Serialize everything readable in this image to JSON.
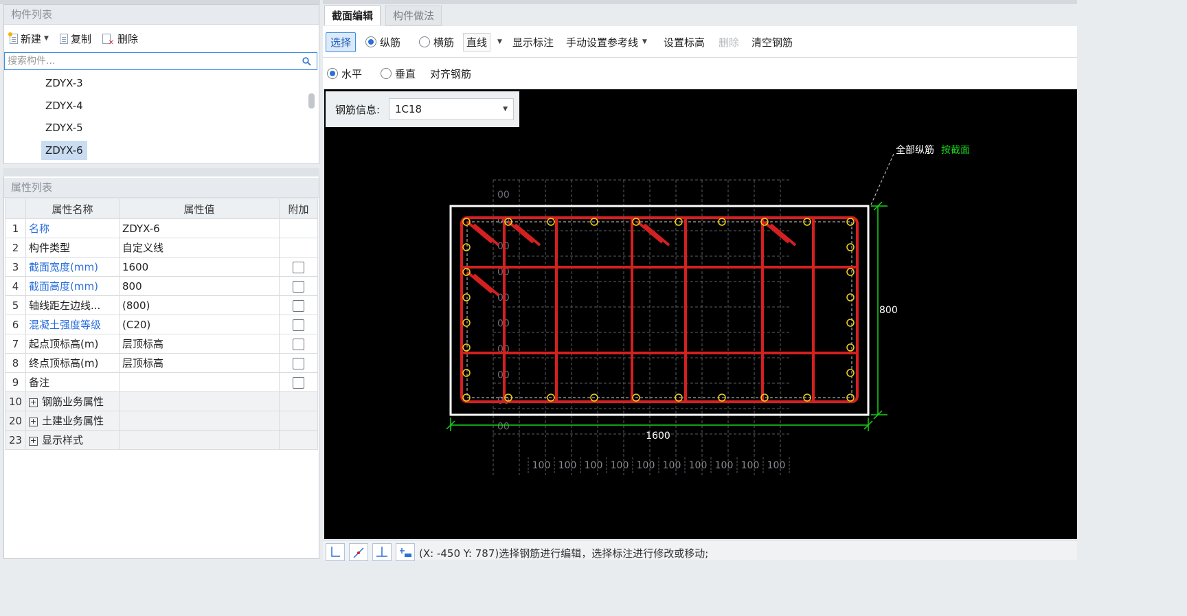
{
  "component_list": {
    "title": "构件列表",
    "toolbar": {
      "new_label": "新建",
      "copy_label": "复制",
      "delete_label": "删除"
    },
    "search_placeholder": "搜索构件...",
    "items": [
      "ZDYX-3",
      "ZDYX-4",
      "ZDYX-5",
      "ZDYX-6"
    ],
    "selected": "ZDYX-6"
  },
  "property_list": {
    "title": "属性列表",
    "columns": [
      "属性名称",
      "属性值",
      "附加"
    ],
    "rows": [
      {
        "num": "1",
        "name": "名称",
        "value": "ZDYX-6",
        "blue": true,
        "checkbox": false
      },
      {
        "num": "2",
        "name": "构件类型",
        "value": "自定义线",
        "blue": false,
        "checkbox": false
      },
      {
        "num": "3",
        "name": "截面宽度(mm)",
        "value": "1600",
        "blue": true,
        "checkbox": true
      },
      {
        "num": "4",
        "name": "截面高度(mm)",
        "value": "800",
        "blue": true,
        "checkbox": true
      },
      {
        "num": "5",
        "name": "轴线距左边线...",
        "value": "(800)",
        "blue": false,
        "checkbox": true
      },
      {
        "num": "6",
        "name": "混凝土强度等级",
        "value": "(C20)",
        "blue": true,
        "checkbox": true
      },
      {
        "num": "7",
        "name": "起点顶标高(m)",
        "value": "层顶标高",
        "blue": false,
        "checkbox": true
      },
      {
        "num": "8",
        "name": "终点顶标高(m)",
        "value": "层顶标高",
        "blue": false,
        "checkbox": true
      },
      {
        "num": "9",
        "name": "备注",
        "value": "",
        "blue": false,
        "checkbox": true
      },
      {
        "num": "10",
        "name": "钢筋业务属性",
        "value": "",
        "group": true
      },
      {
        "num": "20",
        "name": "土建业务属性",
        "value": "",
        "group": true
      },
      {
        "num": "23",
        "name": "显示样式",
        "value": "",
        "group": true
      }
    ]
  },
  "tabs": [
    {
      "label": "截面编辑",
      "active": true
    },
    {
      "label": "构件做法",
      "active": false
    }
  ],
  "toolbar": {
    "select": "选择",
    "longitudinal": "纵筋",
    "transverse": "横筋",
    "line_type": "直线",
    "show_annotation": "显示标注",
    "manual_ref_line": "手动设置参考线",
    "set_elevation": "设置标高",
    "delete": "删除",
    "clear_rebar": "清空钢筋"
  },
  "toolbar2": {
    "horizontal": "水平",
    "vertical": "垂直",
    "align_rebar": "对齐钢筋"
  },
  "rebar_info": {
    "label": "钢筋信息:",
    "value": "1C18"
  },
  "drawing": {
    "all_longitudinal_label": "全部纵筋",
    "by_section_label": "按截面",
    "width_dim": "1600",
    "height_dim": "800",
    "grid_label": "100",
    "grid_left_label": "00",
    "colors": {
      "rebar": "#d42020",
      "outline": "#ffffff",
      "dim": "#19d219",
      "node": "#f2d21b",
      "grid": "#5b5b66",
      "highlight": "#19d219"
    }
  },
  "status": {
    "text": "(X: -450 Y: 787)选择钢筋进行编辑，选择标注进行修改或移动;"
  },
  "icons": [
    "new-icon",
    "copy-icon",
    "delete-icon",
    "search-icon",
    "snap-ortho-icon",
    "snap-line-icon",
    "snap-perp-icon",
    "snap-grid-icon"
  ]
}
